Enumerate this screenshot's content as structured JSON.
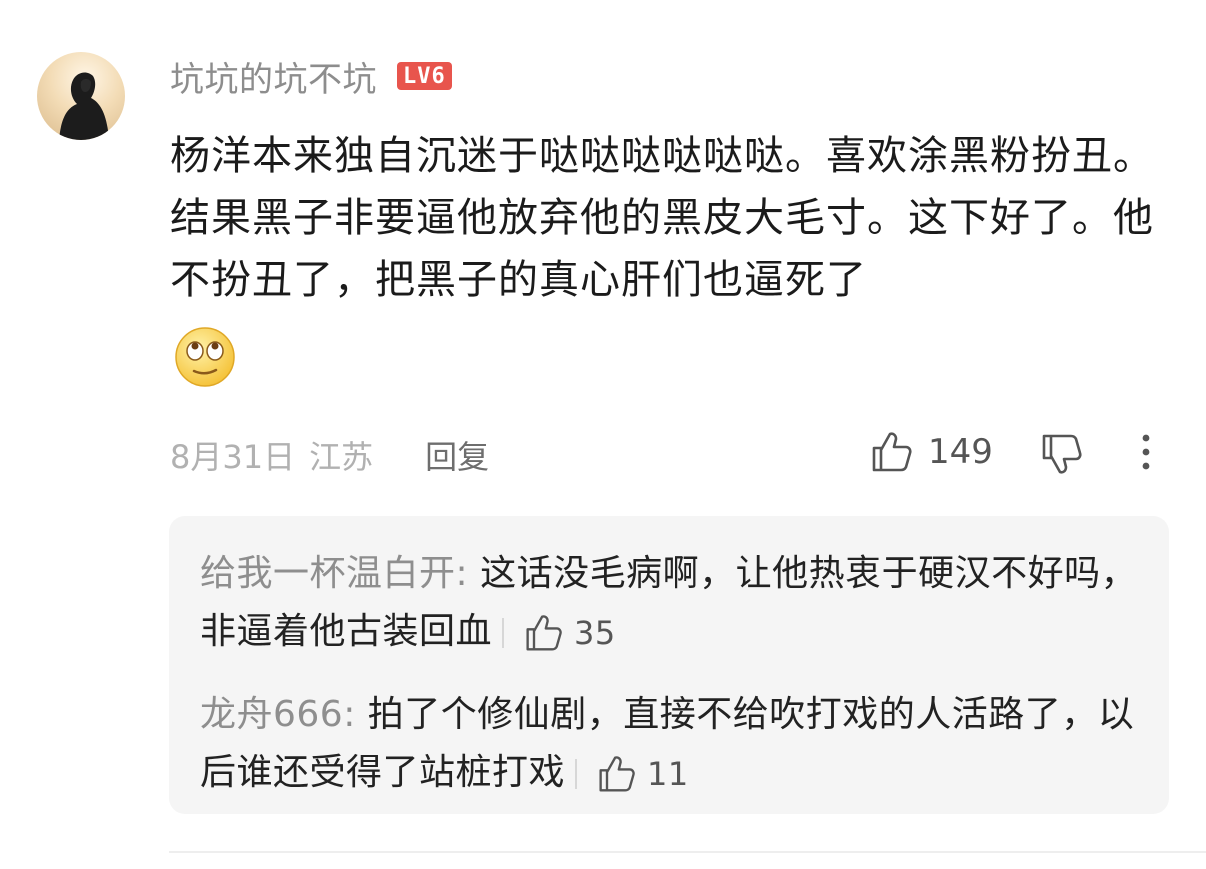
{
  "comment": {
    "username": "坑坑的坑不坑",
    "level": "LV6",
    "text": "杨洋本来独自沉迷于哒哒哒哒哒哒。喜欢涂黑粉扮丑。结果黑子非要逼他放弃他的黑皮大毛寸。这下好了。他不扮丑了，把黑子的真心肝们也逼死了",
    "date": "8月31日",
    "location": "江苏",
    "reply_label": "回复",
    "like_count": "149"
  },
  "replies": [
    {
      "author": "给我一杯温白开:",
      "text": " 这话没毛病啊，让他热衷于硬汉不好吗，非逼着他古装回血",
      "like_count": "35"
    },
    {
      "author": "龙舟666:",
      "text": " 拍了个修仙剧，直接不给吹打戏的人活路了，以后谁还受得了站桩打戏",
      "like_count": "11"
    }
  ],
  "colors": {
    "badge": "#e8554d",
    "username": "#8d8d8d",
    "reply_box": "#f5f5f5"
  },
  "icons": [
    "avatar",
    "rolling-eyes-emoji-icon",
    "thumbs-up-icon",
    "thumbs-down-icon",
    "more-vertical-icon"
  ]
}
